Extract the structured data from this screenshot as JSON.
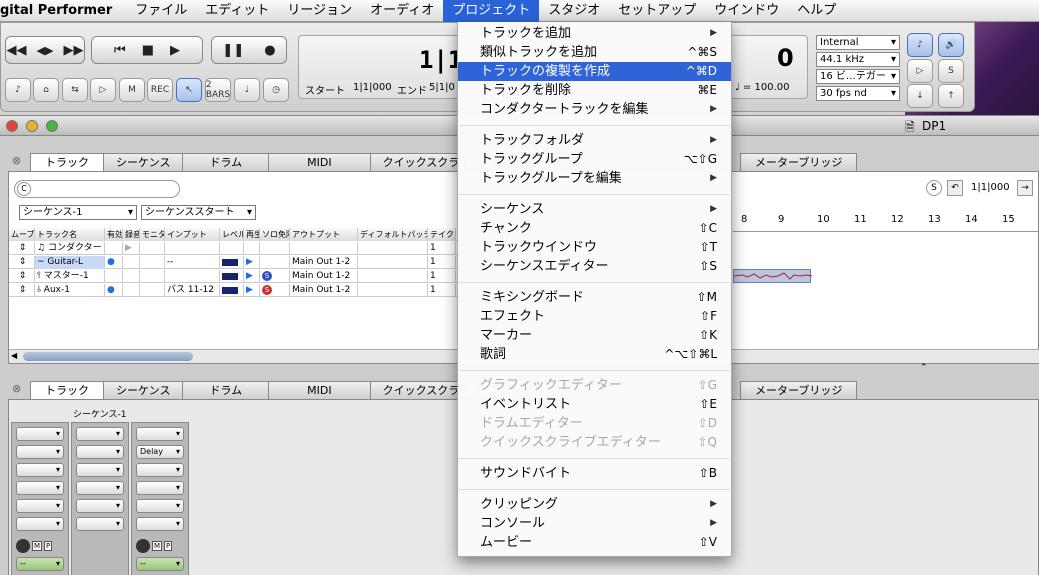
{
  "menubar": {
    "app_name": "gital Performer",
    "items": [
      "ファイル",
      "エディット",
      "リージョン",
      "オーディオ",
      "プロジェクト",
      "スタジオ",
      "セットアップ",
      "ウインドウ",
      "ヘルプ"
    ],
    "active_index": 4
  },
  "transport": {
    "counter_main": "1|1",
    "counter_right": "0",
    "start_label": "スタート",
    "start_value": "1|1|000",
    "end_label": "エンド",
    "end_value": "5|1|0",
    "tempo": "♩ = 100.00",
    "sync": "Internal",
    "sample_rate": "44.1 kHz",
    "bit_depth": "16 ビ…テガー",
    "fps": "30 fps nd",
    "buttons_small": [
      "2 BARS"
    ]
  },
  "window": {
    "title": "DP1",
    "top_tabs": [
      "トラック",
      "シーケンス",
      "ドラム",
      "MIDI",
      "クイックスクライブ",
      "メーターブリッジ"
    ],
    "bottom_tabs": [
      "トラック",
      "シーケンス",
      "ドラム",
      "MIDI",
      "クイックスクライブ",
      "メーターブリッジ"
    ],
    "search_placeholder": "",
    "sequence_select": "シーケンス-1",
    "start_select": "シーケンススタート",
    "locator": "1|1|000",
    "timeline_numbers": [
      "8",
      "9",
      "10",
      "11",
      "12",
      "13",
      "14",
      "15"
    ],
    "track_headers": [
      "ムーブ",
      "トラック名",
      "有効",
      "録音",
      "モニタ",
      "インプット",
      "レベル",
      "再生",
      "ソロ免除",
      "アウトプット",
      "ディフォルトパッチ",
      "テイク"
    ],
    "tracks": [
      {
        "name": "コンダクター",
        "enabled": "",
        "input": "",
        "output": "",
        "take": "1"
      },
      {
        "name": "Guitar-L",
        "enabled": "●",
        "input": "--",
        "output": "Main Out 1-2",
        "take": "1"
      },
      {
        "name": "マスター-1",
        "enabled": "",
        "input": "",
        "output": "Main Out 1-2",
        "take": "1"
      },
      {
        "name": "Aux-1",
        "enabled": "●",
        "input": "バス 11-12",
        "output": "Main Out 1-2",
        "take": "1"
      }
    ],
    "mixer_title": "シーケンス-1",
    "mixer_insert": "Delay"
  },
  "project_menu": [
    {
      "label": "トラックを追加",
      "shortcut": "",
      "submenu": true
    },
    {
      "label": "類似トラックを追加",
      "shortcut": "^⌘S"
    },
    {
      "label": "トラックの複製を作成",
      "shortcut": "^⌘D",
      "highlight": true
    },
    {
      "label": "トラックを削除",
      "shortcut": "⌘E"
    },
    {
      "label": "コンダクタートラックを編集",
      "shortcut": "",
      "submenu": true
    },
    {
      "separator": true
    },
    {
      "label": "トラックフォルダ",
      "shortcut": "",
      "submenu": true
    },
    {
      "label": "トラックグループ",
      "shortcut": "⌥⇧G"
    },
    {
      "label": "トラックグループを編集",
      "shortcut": "",
      "submenu": true
    },
    {
      "separator": true
    },
    {
      "label": "シーケンス",
      "shortcut": "",
      "submenu": true
    },
    {
      "label": "チャンク",
      "shortcut": "⇧C"
    },
    {
      "label": "トラックウインドウ",
      "shortcut": "⇧T"
    },
    {
      "label": "シーケンスエディター",
      "shortcut": "⇧S"
    },
    {
      "separator": true
    },
    {
      "label": "ミキシングボード",
      "shortcut": "⇧M"
    },
    {
      "label": "エフェクト",
      "shortcut": "⇧F"
    },
    {
      "label": "マーカー",
      "shortcut": "⇧K"
    },
    {
      "label": "歌詞",
      "shortcut": "^⌥⇧⌘L"
    },
    {
      "separator": true
    },
    {
      "label": "グラフィックエディター",
      "shortcut": "⇧G",
      "disabled": true
    },
    {
      "label": "イベントリスト",
      "shortcut": "⇧E"
    },
    {
      "label": "ドラムエディター",
      "shortcut": "⇧D",
      "disabled": true
    },
    {
      "label": "クイックスクライブエディター",
      "shortcut": "⇧Q",
      "disabled": true
    },
    {
      "separator": true
    },
    {
      "label": "サウンドバイト",
      "shortcut": "⇧B"
    },
    {
      "separator": true
    },
    {
      "label": "クリッピング",
      "shortcut": "",
      "submenu": true
    },
    {
      "label": "コンソール",
      "shortcut": "",
      "submenu": true
    },
    {
      "label": "ムービー",
      "shortcut": "⇧V"
    }
  ]
}
